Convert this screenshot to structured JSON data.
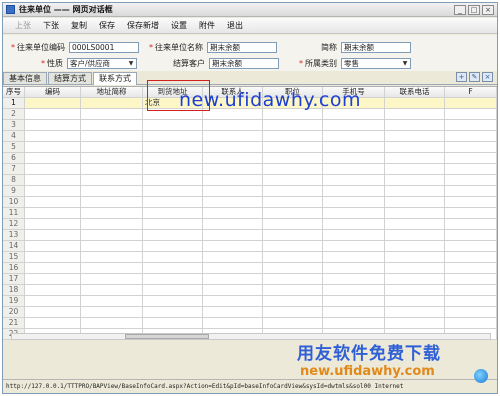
{
  "window": {
    "title": "往来单位 —— 网页对话框",
    "controls": [
      "_",
      "□",
      "×"
    ]
  },
  "toolbar": {
    "items": [
      {
        "label": "上张",
        "enabled": false
      },
      {
        "label": "下张",
        "enabled": true
      },
      {
        "label": "复制",
        "enabled": true
      },
      {
        "label": "保存",
        "enabled": true
      },
      {
        "label": "保存新增",
        "enabled": true
      },
      {
        "label": "设置",
        "enabled": true
      },
      {
        "label": "附件",
        "enabled": true
      },
      {
        "label": "退出",
        "enabled": true
      }
    ]
  },
  "form": {
    "code_label": "往来单位编码",
    "code_value": "000LS0001",
    "name_label": "往来单位名称",
    "name_value": "期末余额",
    "short_label": "简称",
    "short_value": "期末余额",
    "nature_label": "性质",
    "nature_value": "客户/供应商",
    "settle_label": "结算客户",
    "settle_value": "期末余额",
    "category_label": "所属类别",
    "category_value": "零售"
  },
  "tabs": [
    {
      "label": "基本信息",
      "active": false
    },
    {
      "label": "结算方式",
      "active": false
    },
    {
      "label": "联系方式",
      "active": true
    }
  ],
  "tab_tools": [
    "table-add-icon",
    "table-edit-icon",
    "table-delete-icon"
  ],
  "grid": {
    "columns": [
      "序号",
      "编码",
      "地址简称",
      "到货地址",
      "联系人",
      "职位",
      "手机号",
      "联系电话",
      "F"
    ],
    "rows": [
      {
        "num": "1",
        "cells": [
          "",
          "",
          "北京",
          "",
          "",
          "",
          "",
          ""
        ]
      },
      {
        "num": "2"
      },
      {
        "num": "3"
      },
      {
        "num": "4"
      },
      {
        "num": "5"
      },
      {
        "num": "6"
      },
      {
        "num": "7"
      },
      {
        "num": "8"
      },
      {
        "num": "9"
      },
      {
        "num": "10"
      },
      {
        "num": "11"
      },
      {
        "num": "12"
      },
      {
        "num": "13"
      },
      {
        "num": "14"
      },
      {
        "num": "15"
      },
      {
        "num": "16"
      },
      {
        "num": "17"
      },
      {
        "num": "18"
      },
      {
        "num": "19"
      },
      {
        "num": "20"
      },
      {
        "num": "21"
      },
      {
        "num": "22"
      }
    ]
  },
  "watermark": "new.ufidawhy.com",
  "status": {
    "url": "http://127.0.0.1/TTTPRO/BAPView/BaseInfoCard.aspx?Action=Edit&pId=baseInfoCardView&sysId=dwtmls&sol00 Internet"
  },
  "brand": {
    "cn": "用友软件免费下载",
    "url": "new.ufidawhy.com"
  }
}
